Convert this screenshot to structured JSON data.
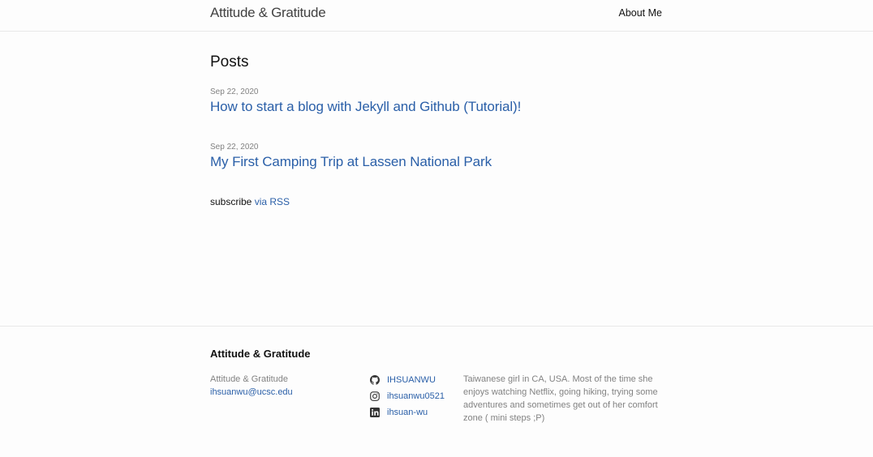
{
  "header": {
    "site_title": "Attitude & Gratitude",
    "nav": [
      {
        "label": "About Me"
      }
    ]
  },
  "main": {
    "heading": "Posts",
    "posts": [
      {
        "date": "Sep 22, 2020",
        "title": "How to start a blog with Jekyll and Github (Tutorial)!"
      },
      {
        "date": "Sep 22, 2020",
        "title": "My First Camping Trip at Lassen National Park"
      }
    ],
    "rss_prefix": "subscribe ",
    "rss_link": "via RSS"
  },
  "footer": {
    "heading": "Attitude & Gratitude",
    "name": "Attitude & Gratitude",
    "email": "ihsuanwu@ucsc.edu",
    "social": [
      {
        "icon": "github-icon",
        "label": "IHSUANWU"
      },
      {
        "icon": "instagram-icon",
        "label": "ihsuanwu0521"
      },
      {
        "icon": "linkedin-icon",
        "label": "ihsuan-wu"
      }
    ],
    "description": "Taiwanese girl in CA, USA. Most of the time she enjoys watching Netflix, going hiking, trying some adventures and sometimes get out of her comfort zone ( mini steps ;P)"
  },
  "colors": {
    "link": "#2a5fa8",
    "meta": "#828282",
    "border": "#e8e8e8",
    "background": "#fdfdfd"
  }
}
